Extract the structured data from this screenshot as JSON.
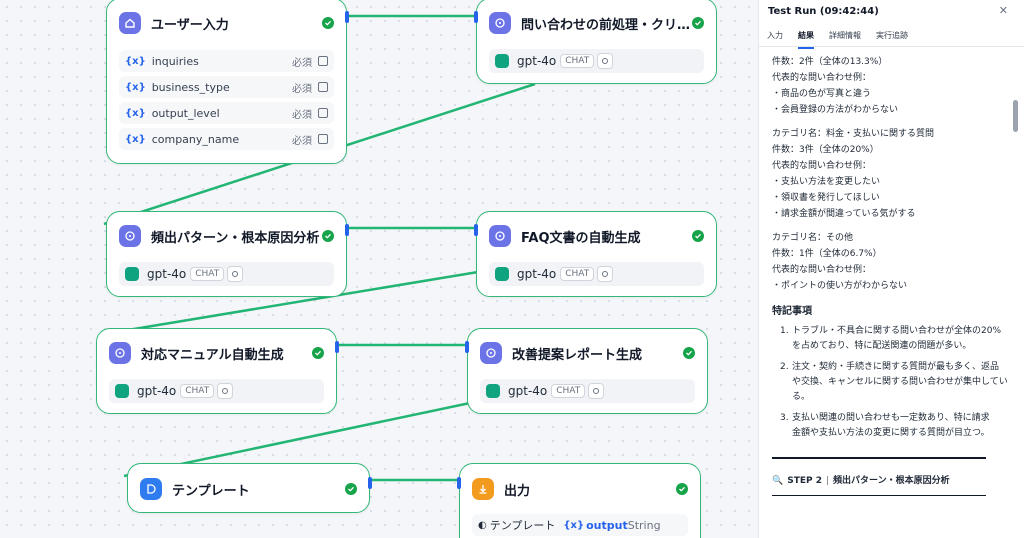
{
  "nodes": {
    "user_input": {
      "title": "ユーザー入力",
      "variables": [
        {
          "name": "inquiries",
          "req": "必須"
        },
        {
          "name": "business_type",
          "req": "必須"
        },
        {
          "name": "output_level",
          "req": "必須"
        },
        {
          "name": "company_name",
          "req": "必須"
        }
      ]
    },
    "preprocess": {
      "title": "問い合わせの前処理・クリー…",
      "model": "gpt-4o",
      "badge": "CHAT"
    },
    "frequent": {
      "title": "頻出パターン・根本原因分析",
      "model": "gpt-4o",
      "badge": "CHAT"
    },
    "faq": {
      "title": "FAQ文書の自動生成",
      "model": "gpt-4o",
      "badge": "CHAT"
    },
    "manual": {
      "title": "対応マニュアル自動生成",
      "model": "gpt-4o",
      "badge": "CHAT"
    },
    "improve": {
      "title": "改善提案レポート生成",
      "model": "gpt-4o",
      "badge": "CHAT"
    },
    "template": {
      "title": "テンプレート"
    },
    "output": {
      "title": "出力",
      "var_source": "テンプレート",
      "var_name": "output",
      "var_type": "String"
    }
  },
  "panel": {
    "title": "Test Run (09:42:44)",
    "tabs": [
      "入力",
      "結果",
      "詳細情報",
      "実行追跡"
    ],
    "active_tab": "結果",
    "lines_a": [
      "件数：2件（全体の13.3%）",
      "代表的な問い合わせ例：",
      "・商品の色が写真と違う",
      "・会員登録の方法がわからない"
    ],
    "lines_b": [
      "カテゴリ名：料金・支払いに関する質問",
      "件数：3件（全体の20%）",
      "代表的な問い合わせ例：",
      "・支払い方法を変更したい",
      "・領収書を発行してほしい",
      "・請求金額が間違っている気がする"
    ],
    "lines_c": [
      "カテゴリ名：その他",
      "件数：1件（全体の6.7%）",
      "代表的な問い合わせ例：",
      "・ポイントの使い方がわからない"
    ],
    "notes_title": "特記事項",
    "notes": [
      {
        "num": "1.",
        "lines": [
          "トラブル・不具合に関する問い合わせが全体の20%",
          "を占めており、特に配送関連の問題が多い。"
        ]
      },
      {
        "num": "2.",
        "lines": [
          "注文・契約・手続きに関する質問が最も多く、返品",
          "や交換、キャンセルに関する問い合わせが集中してい",
          "る。"
        ]
      },
      {
        "num": "3.",
        "lines": [
          "支払い関連の問い合わせも一定数あり、特に請求",
          "金額や支払い方法の変更に関する質問が目立つ。"
        ]
      }
    ],
    "step_label": "STEP 2",
    "step_title": "頻出パターン・根本原因分析"
  }
}
